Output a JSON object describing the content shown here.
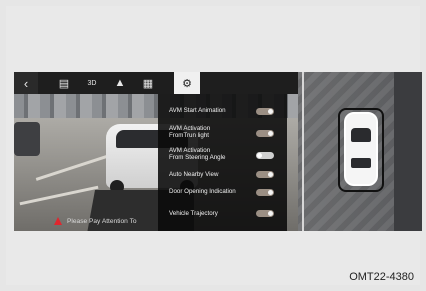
{
  "topbar": {
    "back_icon": "chevron-left-icon",
    "buttons": [
      "camera-front-icon",
      "3d-view-icon",
      "car-top-icon",
      "car-side-icon",
      "settings-gear-icon"
    ],
    "labels": {
      "3d": "3D"
    }
  },
  "settings": {
    "items": [
      {
        "label": "AVM Start Animation",
        "on": true
      },
      {
        "label": "AVM Activation\nFromTrun light",
        "on": true
      },
      {
        "label": "AVM Activation\nFrom Steering Angle",
        "on": false
      },
      {
        "label": "Auto Nearby View",
        "on": true
      },
      {
        "label": "Door Opening Indication",
        "on": true
      },
      {
        "label": "Vehicle Trajectory",
        "on": true
      }
    ]
  },
  "warning": {
    "text": "Please Pay Attention To"
  },
  "figure_code": "OMT22-4380",
  "colors": {
    "warning": "#e0262e",
    "toggle_on": "#9b8f84",
    "panel": "#0a0a0a"
  }
}
